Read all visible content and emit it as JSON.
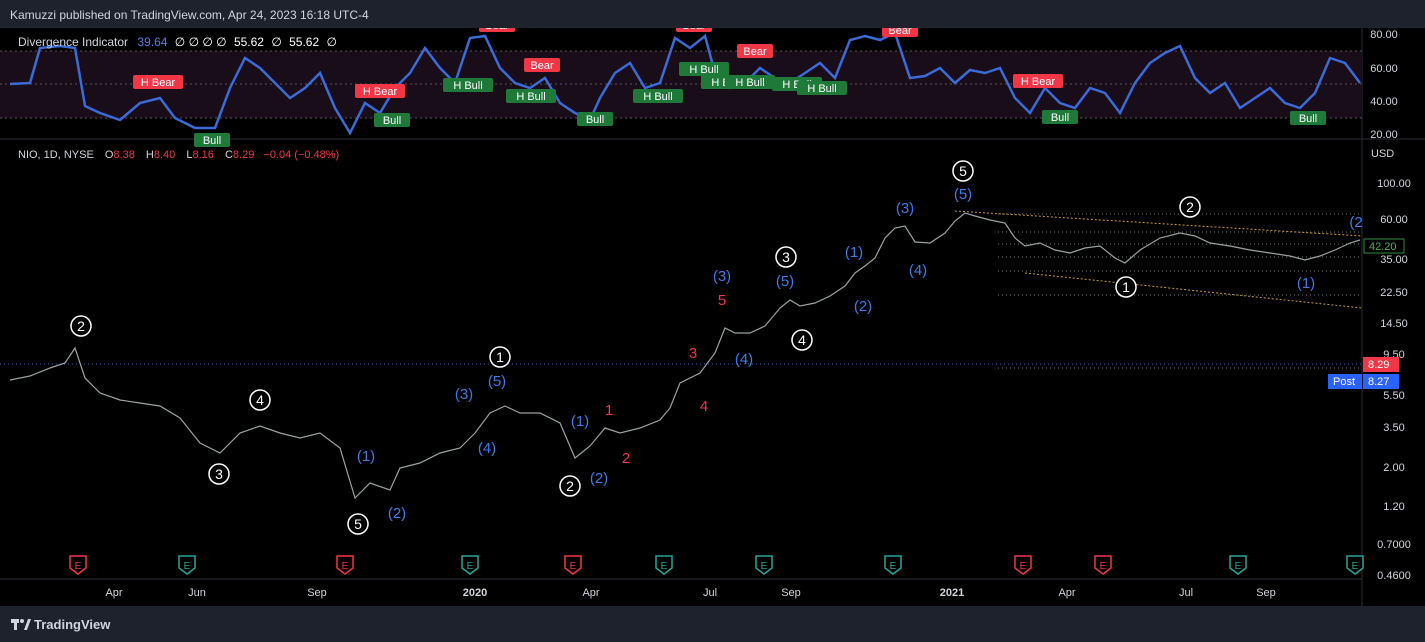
{
  "header": {
    "published": "Kamuzzi published on TradingView.com, Apr 24, 2023 16:18 UTC-4"
  },
  "oscillator": {
    "name": "Divergence Indicator",
    "value1": "39.64",
    "zeros": "∅ ∅ ∅ ∅",
    "value2": "55.62",
    "value3": "55.62",
    "zero_last": "∅",
    "axis_ticks": [
      "80.00",
      "60.00",
      "40.00",
      "20.00"
    ],
    "tags": [
      {
        "label": "H Bear",
        "kind": "bear"
      },
      {
        "label": "Bull",
        "kind": "bull"
      },
      {
        "label": "H Bear",
        "kind": "bear"
      },
      {
        "label": "Bull",
        "kind": "bull"
      },
      {
        "label": "Bear",
        "kind": "bear"
      },
      {
        "label": "H Bull",
        "kind": "bull"
      },
      {
        "label": "Bear",
        "kind": "bear"
      },
      {
        "label": "H Bull",
        "kind": "bull"
      },
      {
        "label": "Bull",
        "kind": "bull"
      },
      {
        "label": "H Bull",
        "kind": "bull"
      },
      {
        "label": "Bear",
        "kind": "bear"
      },
      {
        "label": "H Bull",
        "kind": "bull"
      },
      {
        "label": "Bear",
        "kind": "bear"
      },
      {
        "label": "H Bull",
        "kind": "bull"
      },
      {
        "label": "H Bull",
        "kind": "bull"
      },
      {
        "label": "H Bull",
        "kind": "bull"
      },
      {
        "label": "H Bull",
        "kind": "bull"
      },
      {
        "label": "Bear",
        "kind": "bear"
      },
      {
        "label": "H Bear",
        "kind": "bear"
      },
      {
        "label": "Bull",
        "kind": "bull"
      },
      {
        "label": "Bull",
        "kind": "bull"
      }
    ]
  },
  "main": {
    "symbol": "NIO, 1D, NYSE",
    "open_label": "O",
    "open": "8.38",
    "high_label": "H",
    "high": "8.40",
    "low_label": "L",
    "low": "8.16",
    "close_label": "C",
    "close": "8.29",
    "change": "−0.04 (−0.48%)",
    "currency": "USD",
    "price_ticks": [
      "100.00",
      "60.00",
      "35.00",
      "22.50",
      "14.50",
      "9.50",
      "5.50",
      "3.50",
      "2.00",
      "1.20",
      "0.7000",
      "0.4600"
    ],
    "last_price": "8.29",
    "post_label": "Post",
    "post_price": "8.27",
    "right_value": "42.20"
  },
  "time_axis": [
    "Apr",
    "Jun",
    "Sep",
    "2020",
    "Apr",
    "Jul",
    "Sep",
    "2021",
    "Apr",
    "Jul",
    "Sep"
  ],
  "wave_labels": [
    {
      "text": "2",
      "style": "circled"
    },
    {
      "text": "4",
      "style": "circled"
    },
    {
      "text": "3",
      "style": "circled"
    },
    {
      "text": "5",
      "style": "circled"
    },
    {
      "text": "(1)",
      "style": "blue"
    },
    {
      "text": "(2)",
      "style": "blue"
    },
    {
      "text": "(3)",
      "style": "blue"
    },
    {
      "text": "(4)",
      "style": "blue"
    },
    {
      "text": "1",
      "style": "circled"
    },
    {
      "text": "(5)",
      "style": "blue"
    },
    {
      "text": "(1)",
      "style": "blue"
    },
    {
      "text": "2",
      "style": "circled"
    },
    {
      "text": "(2)",
      "style": "blue"
    },
    {
      "text": "1",
      "style": "red"
    },
    {
      "text": "2",
      "style": "red"
    },
    {
      "text": "3",
      "style": "red"
    },
    {
      "text": "4",
      "style": "red"
    },
    {
      "text": "5",
      "style": "red"
    },
    {
      "text": "(3)",
      "style": "blue"
    },
    {
      "text": "(4)",
      "style": "blue"
    },
    {
      "text": "3",
      "style": "circled"
    },
    {
      "text": "(5)",
      "style": "blue"
    },
    {
      "text": "4",
      "style": "circled"
    },
    {
      "text": "(1)",
      "style": "blue"
    },
    {
      "text": "(2)",
      "style": "blue"
    },
    {
      "text": "(3)",
      "style": "blue"
    },
    {
      "text": "(4)",
      "style": "blue"
    },
    {
      "text": "5",
      "style": "circled"
    },
    {
      "text": "(5)",
      "style": "blue"
    },
    {
      "text": "2",
      "style": "circled"
    },
    {
      "text": "1",
      "style": "circled"
    },
    {
      "text": "(1)",
      "style": "blue"
    },
    {
      "text": "(2",
      "style": "blue"
    }
  ],
  "events": [
    "E",
    "E",
    "E",
    "E",
    "E",
    "E",
    "E",
    "E",
    "E",
    "E",
    "E",
    "E",
    "E",
    "E",
    "E",
    "E"
  ],
  "footer": {
    "brand": "TradingView"
  },
  "colors": {
    "background": "#000000",
    "bar": "#1e222d",
    "osc_line": "#3a6bd8",
    "bull": "#1f7a3a",
    "bear": "#f23645",
    "wave_blue": "#3d7be8",
    "wave_red": "#f0334f",
    "price_tag": "#f23645",
    "post_tag": "#2962ff"
  }
}
